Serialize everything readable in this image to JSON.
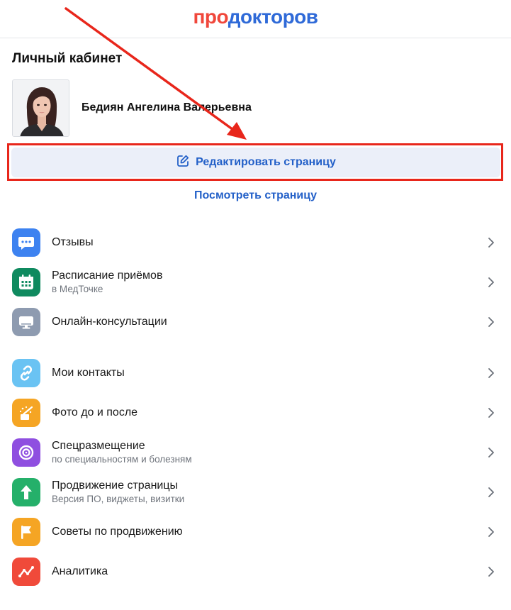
{
  "header": {
    "logo_part1": "про",
    "logo_part2": "докторов"
  },
  "profile": {
    "title": "Личный кабинет",
    "doctor_name": "Бедиян Ангелина Валерьевна"
  },
  "actions": {
    "edit_label": "Редактировать страницу",
    "view_label": "Посмотреть страницу"
  },
  "menu": {
    "items": [
      {
        "label": "Отзывы",
        "sub": "",
        "icon": "chat-bubble-icon",
        "color": "#3d82f0"
      },
      {
        "label": "Расписание приёмов",
        "sub": "в МедТочке",
        "icon": "calendar-icon",
        "color": "#0f8a5f"
      },
      {
        "label": "Онлайн-консультации",
        "sub": "",
        "icon": "monitor-icon",
        "color": "#8e9bb0"
      },
      {
        "label": "Мои контакты",
        "sub": "",
        "icon": "link-icon",
        "color": "#6ac3f3"
      },
      {
        "label": "Фото до и после",
        "sub": "",
        "icon": "magic-wand-icon",
        "color": "#f5a524"
      },
      {
        "label": "Спецразмещение",
        "sub": "по специальностям и болезням",
        "icon": "target-icon",
        "color": "#8f4fe0"
      },
      {
        "label": "Продвижение страницы",
        "sub": "Версия ПО, виджеты, визитки",
        "icon": "arrow-up-icon",
        "color": "#25b06a"
      },
      {
        "label": "Советы по продвижению",
        "sub": "",
        "icon": "flag-icon",
        "color": "#f5a524"
      },
      {
        "label": "Аналитика",
        "sub": "",
        "icon": "analytics-icon",
        "color": "#f04a3a"
      }
    ]
  },
  "colors": {
    "accent_blue": "#2360c8",
    "brand_red": "#f0473b",
    "brand_blue": "#2f6ad8",
    "annotation_red": "#e8261b",
    "edit_button_bg": "#ebeff9"
  }
}
